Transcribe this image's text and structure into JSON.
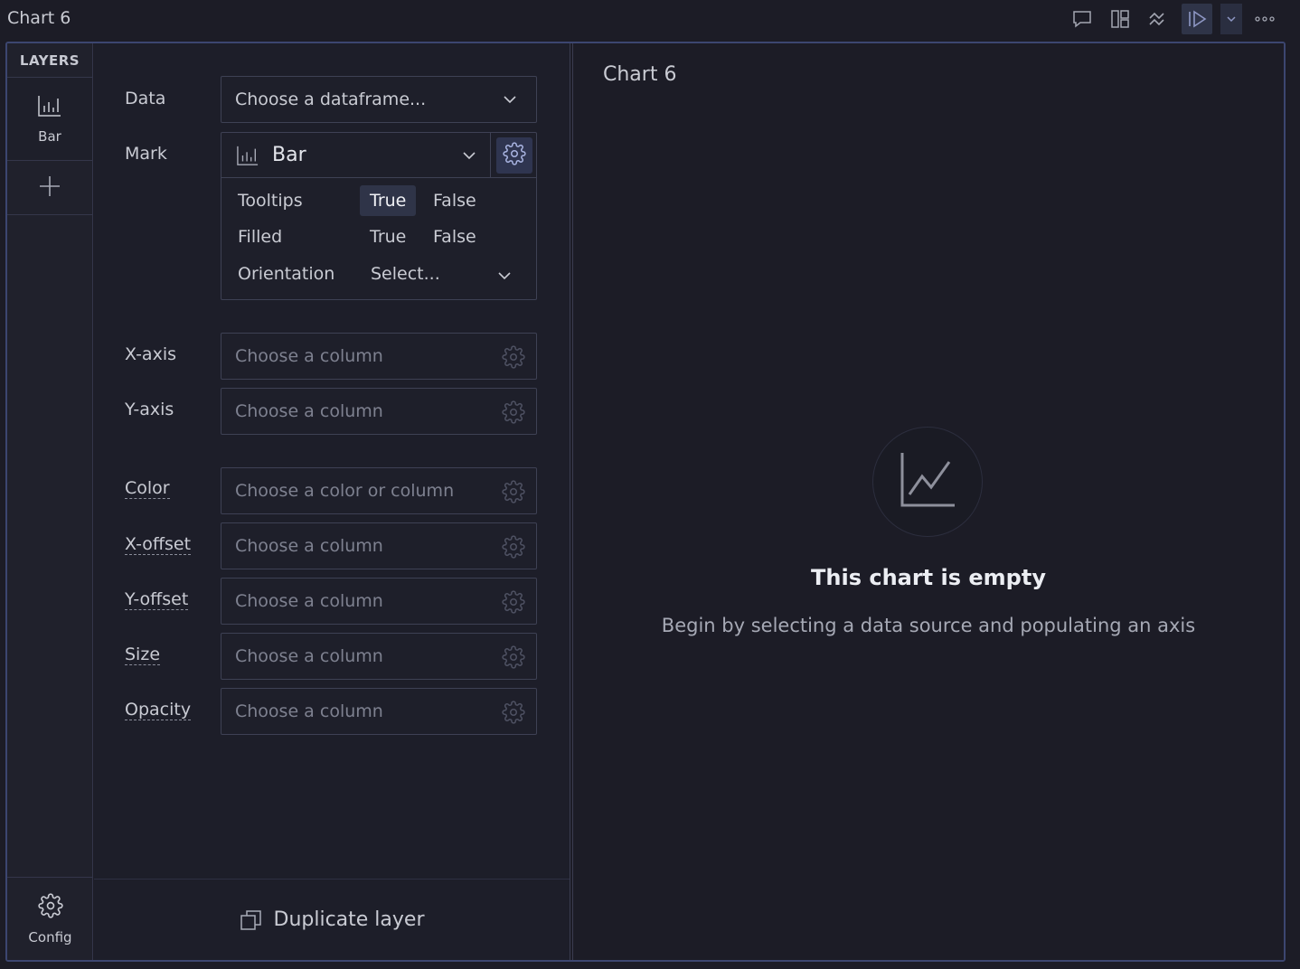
{
  "window": {
    "title": "Chart 6"
  },
  "toolbar": {
    "icons": [
      "comment-icon",
      "layout-icon",
      "collapse-icon",
      "run-icon",
      "chevron-down-icon",
      "more-icon"
    ]
  },
  "layers": {
    "header": "LAYERS",
    "items": [
      {
        "label": "Bar",
        "icon": "bar-chart-icon"
      }
    ],
    "add_icon": "plus-icon",
    "config_label": "Config"
  },
  "properties": {
    "data": {
      "label": "Data",
      "value": "Choose a dataframe..."
    },
    "mark": {
      "label": "Mark",
      "value": "Bar",
      "options": {
        "tooltips": {
          "label": "Tooltips",
          "true_label": "True",
          "false_label": "False",
          "selected": "True"
        },
        "filled": {
          "label": "Filled",
          "true_label": "True",
          "false_label": "False",
          "selected": null
        },
        "orientation": {
          "label": "Orientation",
          "placeholder": "Select..."
        }
      }
    },
    "x_axis": {
      "label": "X-axis",
      "placeholder": "Choose a column"
    },
    "y_axis": {
      "label": "Y-axis",
      "placeholder": "Choose a column"
    },
    "color": {
      "label": "Color",
      "placeholder": "Choose a color or column"
    },
    "x_offset": {
      "label": "X-offset",
      "placeholder": "Choose a column"
    },
    "y_offset": {
      "label": "Y-offset",
      "placeholder": "Choose a column"
    },
    "size": {
      "label": "Size",
      "placeholder": "Choose a column"
    },
    "opacity": {
      "label": "Opacity",
      "placeholder": "Choose a column"
    },
    "duplicate_label": "Duplicate layer"
  },
  "chart": {
    "title": "Chart 6",
    "empty_title": "This chart is empty",
    "empty_subtitle": "Begin by selecting a data source and populating an axis"
  }
}
